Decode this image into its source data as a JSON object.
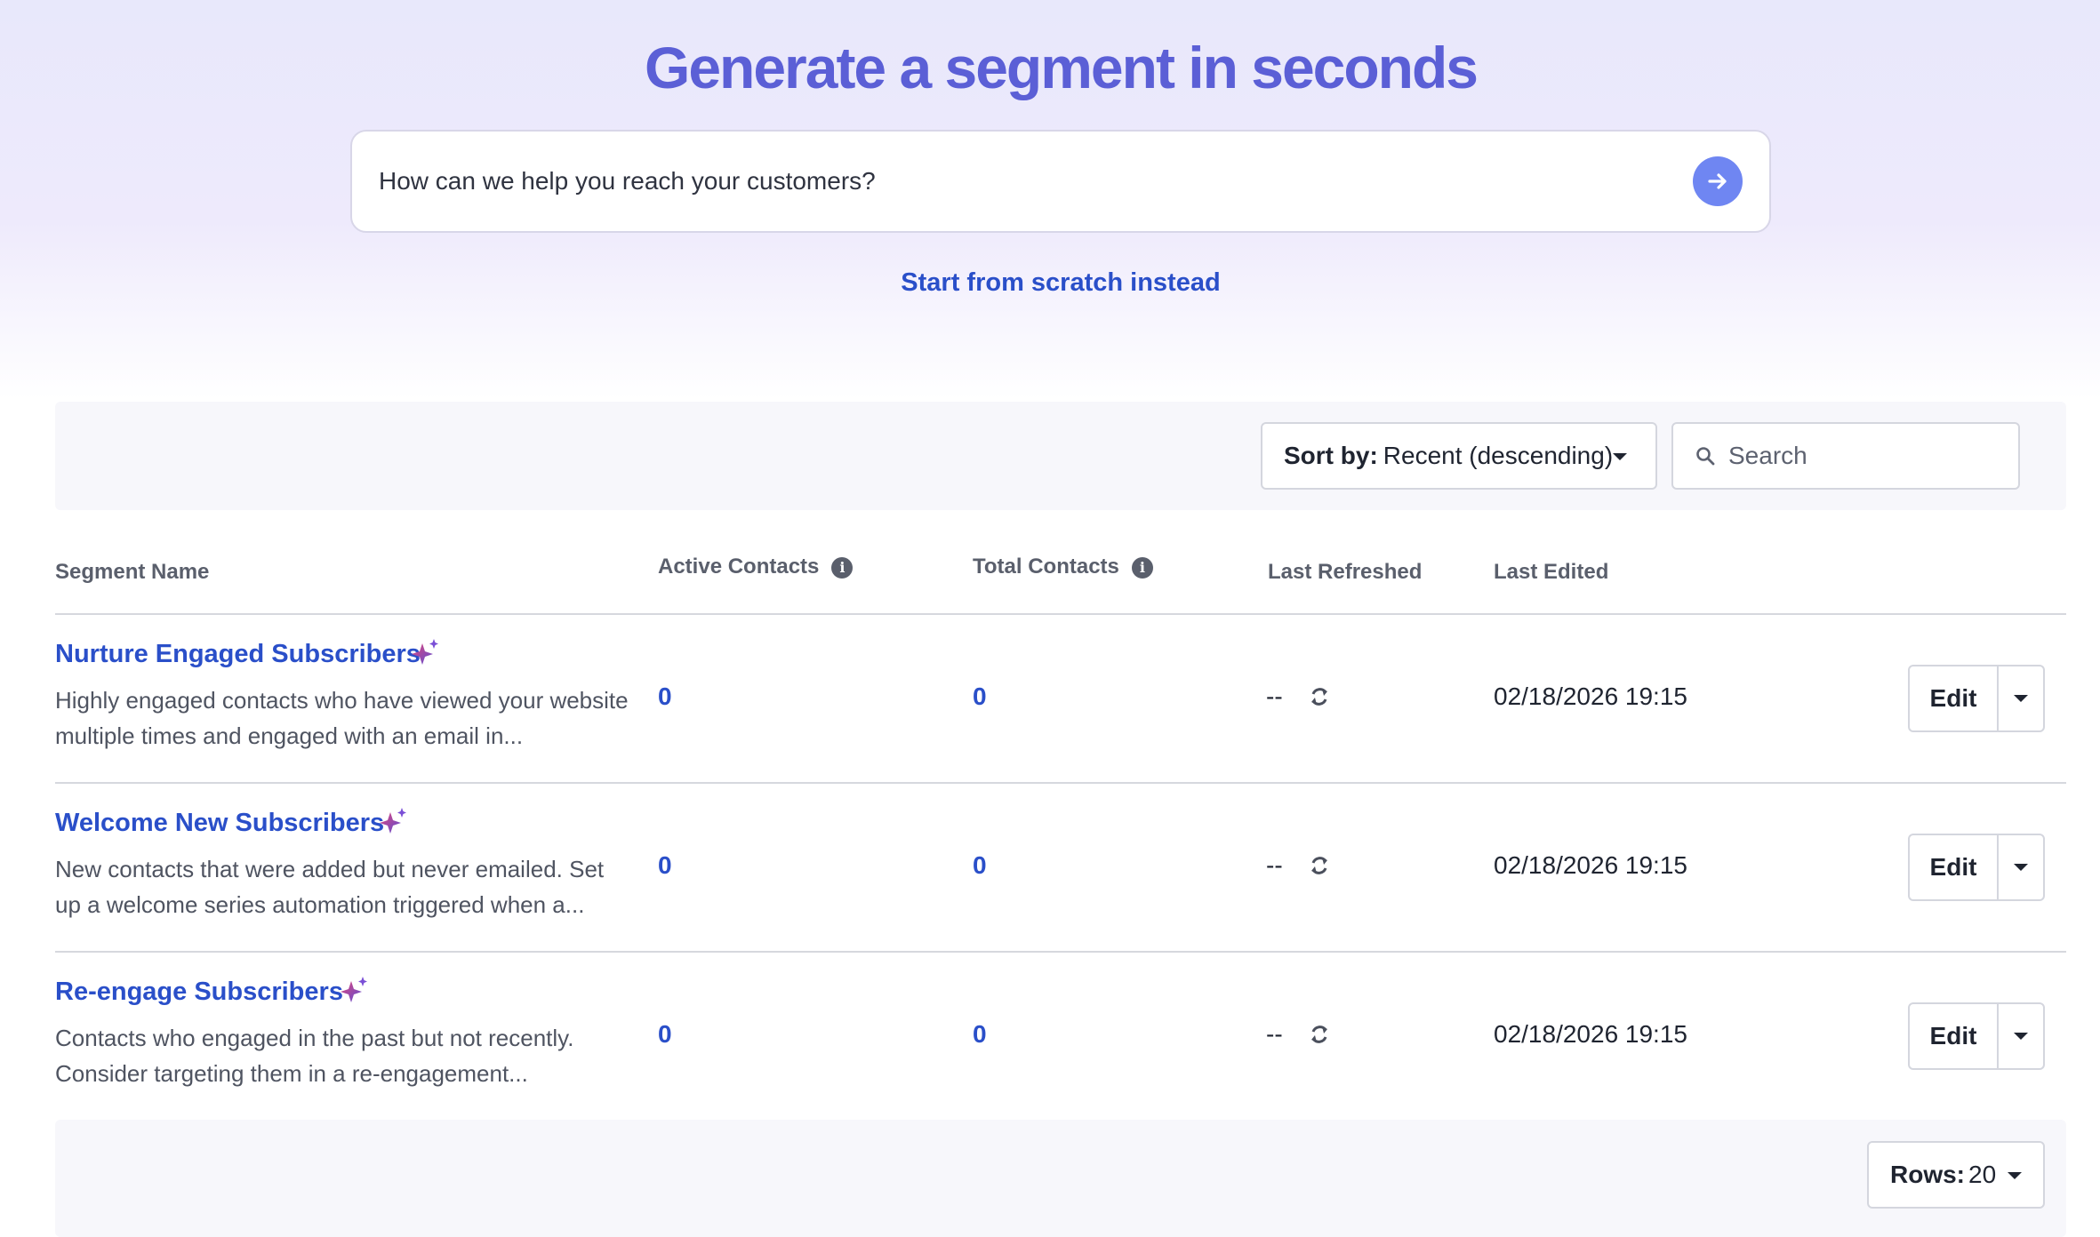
{
  "hero": {
    "title": "Generate a segment in seconds",
    "prompt_placeholder": "How can we help you reach your customers?",
    "submit_icon": "arrow-right-icon",
    "scratch_link": "Start from scratch instead"
  },
  "toolbar": {
    "sort_label": "Sort by:",
    "sort_value": "Recent (descending)",
    "search_placeholder": "Search"
  },
  "table": {
    "headers": {
      "segment_name": "Segment Name",
      "active_contacts": "Active Contacts",
      "total_contacts": "Total Contacts",
      "last_refreshed": "Last Refreshed",
      "last_edited": "Last Edited"
    },
    "rows": [
      {
        "name": "Nurture Engaged Subscribers",
        "description": "Highly engaged contacts who have viewed your website multiple times and engaged with an email in...",
        "active": "0",
        "total": "0",
        "refreshed": "--",
        "edited": "02/18/2026 19:15",
        "edit_label": "Edit"
      },
      {
        "name": "Welcome New Subscribers",
        "description": "New contacts that were added but never emailed. Set up a welcome series automation triggered when a...",
        "active": "0",
        "total": "0",
        "refreshed": "--",
        "edited": "02/18/2026 19:15",
        "edit_label": "Edit"
      },
      {
        "name": "Re-engage Subscribers",
        "description": "Contacts who engaged in the past but not recently. Consider targeting them in a re-engagement...",
        "active": "0",
        "total": "0",
        "refreshed": "--",
        "edited": "02/18/2026 19:15",
        "edit_label": "Edit"
      }
    ]
  },
  "footer": {
    "rows_label": "Rows:",
    "rows_value": "20"
  },
  "colors": {
    "accent": "#2a4fc9",
    "title": "#5b5fd6",
    "submit": "#6f86f2"
  }
}
